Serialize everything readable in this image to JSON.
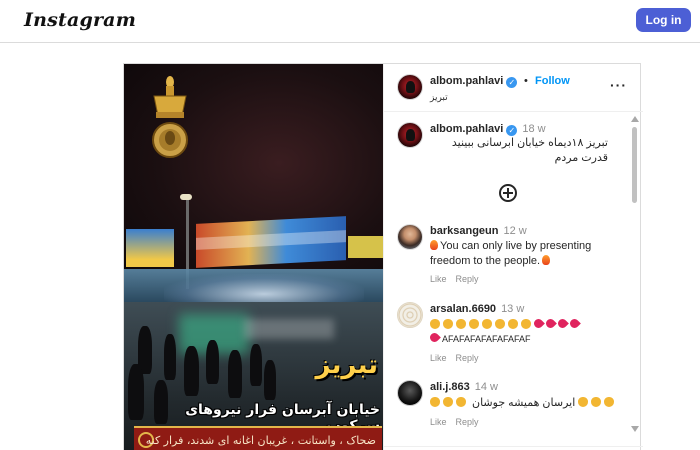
{
  "nav": {
    "brand": "Instagram",
    "login_label": "Log in"
  },
  "post": {
    "header": {
      "username": "albom.pahlavi",
      "verified_mark": "✓",
      "separator": "•",
      "follow_label": "Follow",
      "location": "تبریز",
      "more_label": "···"
    },
    "caption": {
      "username": "albom.pahlavi",
      "time": "18 w",
      "text": "تبریز ۱۸دیماه خیابان ابرسانی ببینید قدرت مردم"
    },
    "media": {
      "overlay_title": "تبریز",
      "overlay_subtitle": "خیابان آبرسان  فرار نیروهای سرکوب",
      "overlay_band": "ضحاک ، واستانت ، غریبان اغانه ای شدند، فرار کنه آتیم"
    },
    "load_more_icon": "plus-circle-icon",
    "comments": [
      {
        "username": "barksangeun",
        "time": "12 w",
        "text": "You can only live by presenting freedom to the people.",
        "like_label": "Like",
        "reply_label": "Reply"
      },
      {
        "username": "arsalan.6690",
        "time": "13 w",
        "text": "AFAFAFAFAFAFAFAF",
        "like_label": "Like",
        "reply_label": "Reply"
      },
      {
        "username": "ali.j.863",
        "time": "14 w",
        "text": "ایرسان همیشه جوشان",
        "like_label": "Like",
        "reply_label": "Reply"
      }
    ]
  },
  "colors": {
    "accent": "#0095f6",
    "login_button": "#4c5fd5",
    "verified": "#3897f0",
    "text_primary": "#262626",
    "text_secondary": "#8e8e8e",
    "border": "#dbdbdb"
  }
}
